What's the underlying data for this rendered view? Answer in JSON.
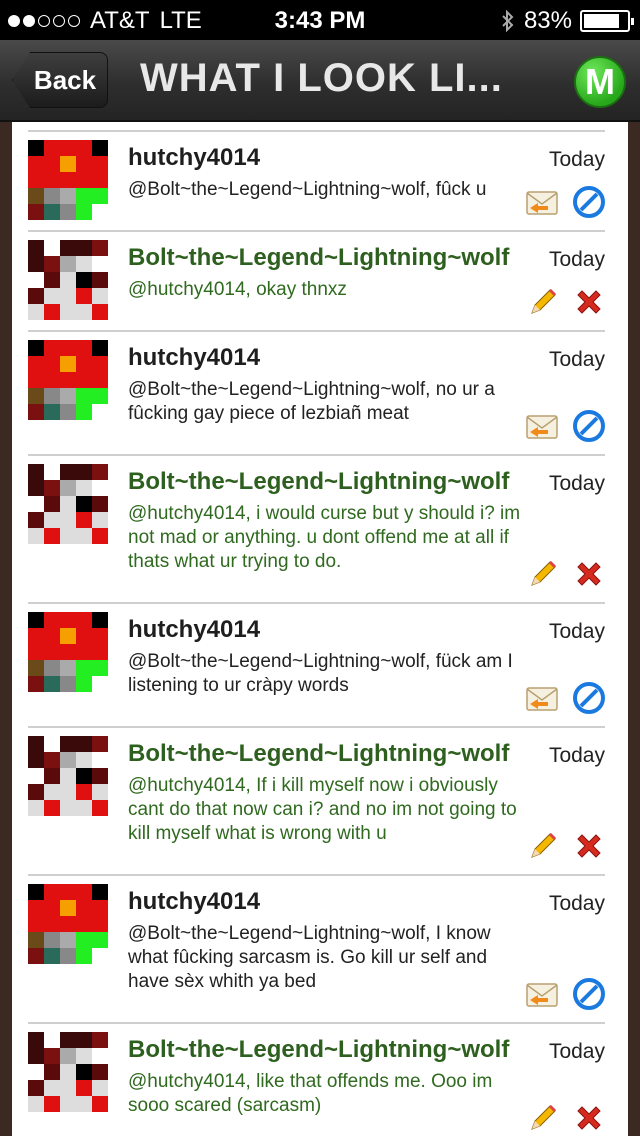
{
  "status": {
    "carrier": "AT&T",
    "network": "LTE",
    "time": "3:43 PM",
    "battery": "83%",
    "battery_level": 0.83,
    "signal_bars_on": 2
  },
  "nav": {
    "back_label": "Back",
    "title": "WHAT I LOOK LI...",
    "logo_letter": "M"
  },
  "posts": [
    {
      "user": "hutchy4014",
      "date": "Today",
      "message": "@Bolt~the~Legend~Lightning~wolf, fûck u",
      "own": false
    },
    {
      "user": "Bolt~the~Legend~Lightning~wolf",
      "date": "Today",
      "message": "@hutchy4014, okay thnxz",
      "own": true
    },
    {
      "user": "hutchy4014",
      "date": "Today",
      "message": "@Bolt~the~Legend~Lightning~wolf, no ur a fûcking gay piece of lezbiañ meat",
      "own": false
    },
    {
      "user": "Bolt~the~Legend~Lightning~wolf",
      "date": "Today",
      "message": "@hutchy4014, i would curse but y should i? im not mad or anything. u dont offend me at all if thats what ur trying to do.",
      "own": true
    },
    {
      "user": "hutchy4014",
      "date": "Today",
      "message": "@Bolt~the~Legend~Lightning~wolf, fück am I listening to ur cràpy words",
      "own": false
    },
    {
      "user": "Bolt~the~Legend~Lightning~wolf",
      "date": "Today",
      "message": "@hutchy4014, If i kill myself now i obviously cant do that now can i? and no im not going to kill myself what is wrong with u",
      "own": true
    },
    {
      "user": "hutchy4014",
      "date": "Today",
      "message": "@Bolt~the~Legend~Lightning~wolf, I know what fûcking sarcasm is. Go kill ur self and have sèx whith ya bed",
      "own": false
    },
    {
      "user": "Bolt~the~Legend~Lightning~wolf",
      "date": "Today",
      "message": "@hutchy4014, like that offends me. Ooo im sooo scared (sarcasm)",
      "own": true
    }
  ],
  "colors": {
    "own_user": "#2d5f1e",
    "own_message": "#2f6a1f",
    "other_user": "#1e1e1e",
    "nav_bg": "#2e2e2e",
    "logo_green": "#27a81b"
  },
  "icons": {
    "reply": "mail-reply-icon",
    "block": "block-icon",
    "edit": "pencil-icon",
    "delete": "delete-x-icon"
  }
}
